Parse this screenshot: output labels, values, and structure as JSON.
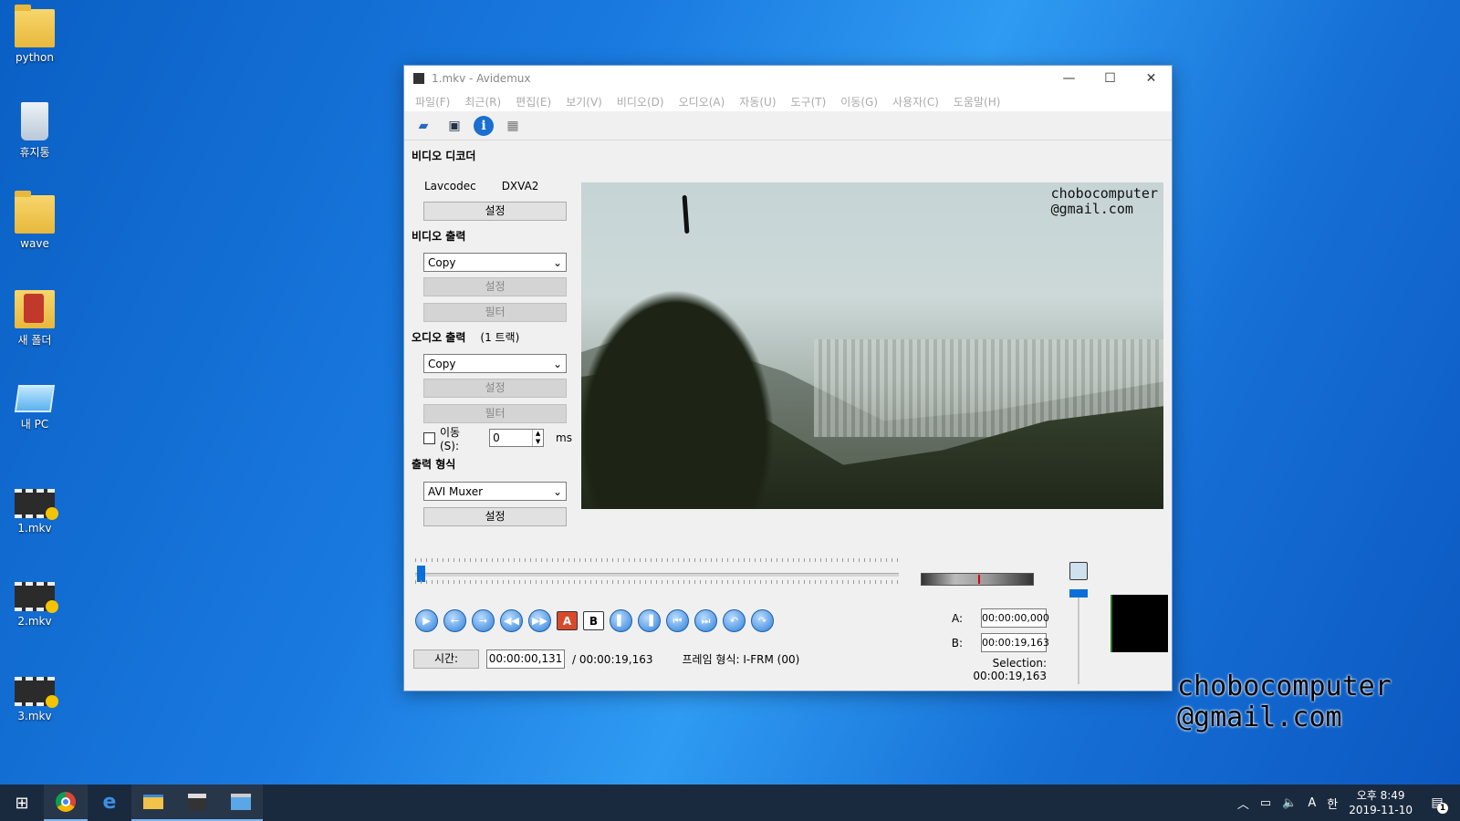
{
  "desktop": {
    "icons": [
      {
        "label": "python"
      },
      {
        "label": "휴지통"
      },
      {
        "label": "wave"
      },
      {
        "label": "새 폴더"
      },
      {
        "label": "내 PC"
      },
      {
        "label": "1.mkv"
      },
      {
        "label": "2.mkv"
      },
      {
        "label": "3.mkv"
      }
    ]
  },
  "window": {
    "title": "1.mkv - Avidemux",
    "controls": {
      "minimize": "—",
      "maximize": "☐",
      "close": "✕"
    }
  },
  "menu": [
    "파일(F)",
    "최근(R)",
    "편집(E)",
    "보기(V)",
    "비디오(D)",
    "오디오(A)",
    "자동(U)",
    "도구(T)",
    "이동(G)",
    "사용자(C)",
    "도움말(H)"
  ],
  "toolbar": {
    "icons": [
      "open-icon",
      "save-icon",
      "info-icon",
      "film-icon"
    ],
    "info_glyph": "i"
  },
  "video_decoder": {
    "title": "비디오 디코더",
    "codec": "Lavcodec",
    "accel": "DXVA2",
    "settings_label": "설정"
  },
  "video_output": {
    "title": "비디오 출력",
    "selected": "Copy",
    "settings_label": "설정",
    "filter_label": "필터"
  },
  "audio_output": {
    "title": "오디오 출력",
    "tracks": "(1 트랙)",
    "selected": "Copy",
    "settings_label": "설정",
    "filter_label": "필터",
    "shift_label": "이동(S):",
    "shift_value": "0",
    "shift_unit": "ms"
  },
  "output_format": {
    "title": "출력 형식",
    "selected": "AVI Muxer",
    "settings_label": "설정"
  },
  "preview": {
    "watermark_line1": "chobocomputer",
    "watermark_line2": "@gmail.com"
  },
  "playback": {
    "buttons": [
      "play",
      "prev-frame",
      "next-frame",
      "prev-keyframe",
      "next-keyframe",
      "set-marker-a",
      "set-marker-b",
      "prev-black",
      "next-black",
      "go-first",
      "go-last",
      "back-60",
      "forward-60"
    ],
    "mark_a_glyph": "A",
    "mark_b_glyph": "B",
    "position_fraction": 0.007
  },
  "time": {
    "button_label": "시간:",
    "current": "00:00:00,131",
    "total": "/ 00:00:19,163",
    "frame_type": "프레임 형식: I-FRM (00)"
  },
  "markers": {
    "a_label": "A:",
    "a_value": "00:00:00,000",
    "b_label": "B:",
    "b_value": "00:00:19,163",
    "selection": "Selection: 00:00:19,163"
  },
  "watermark": {
    "line1": "chobocomputer",
    "line2": "@gmail.com"
  },
  "taskbar": {
    "apps": [
      "chrome",
      "edge",
      "file-explorer",
      "clapper",
      "avidemux"
    ],
    "clock_time": "오후 8:49",
    "clock_date": "2019-11-10",
    "ime_mode": "A",
    "ime_lang": "한",
    "notification_count": "1"
  }
}
